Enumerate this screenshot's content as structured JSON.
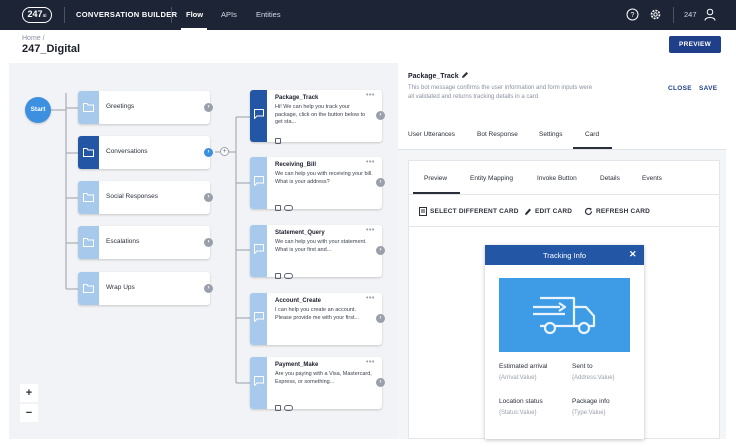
{
  "topbar": {
    "logo": "247",
    "logo_suffix": "ai",
    "app_title": "CONVERSATION BUILDER",
    "tabs": [
      {
        "label": "Flow",
        "active": true
      },
      {
        "label": "APIs",
        "active": false
      },
      {
        "label": "Entities",
        "active": false
      }
    ],
    "icons": [
      "help-icon",
      "gear-icon",
      "user-icon"
    ],
    "user_number": "247"
  },
  "header": {
    "breadcrumb": "Home /",
    "title": "247_Digital",
    "preview_label": "PREVIEW"
  },
  "flow": {
    "start_label": "Start",
    "categories": [
      {
        "label": "Greetings",
        "active": false
      },
      {
        "label": "Conversations",
        "active": true
      },
      {
        "label": "Social Responses",
        "active": false
      },
      {
        "label": "Escalations",
        "active": false
      },
      {
        "label": "Wrap Ups",
        "active": false
      }
    ],
    "messages": [
      {
        "title": "Package_Track",
        "text": "Hi! We can help you track your package, click on the button below to get sta...",
        "active": true
      },
      {
        "title": "Receiving_Bill",
        "text": "We can help you with receiving your bill. What is your address?",
        "active": false
      },
      {
        "title": "Statement_Query",
        "text": "We can help you with your statement. What is your first and...",
        "active": false
      },
      {
        "title": "Account_Create",
        "text": "I can help you create an account. Please provide me with your first...",
        "active": false
      },
      {
        "title": "Payment_Make",
        "text": "Are you paying with a Visa, Mastercard, Express, or something...",
        "active": false
      }
    ],
    "more_glyph": "•••",
    "chevron_glyph": "›",
    "zoom_in": "+",
    "zoom_out": "−"
  },
  "panel": {
    "title": "Package_Track",
    "description": "This bot message confirms the user information and form inputs were all validated and returns tracking details in a card",
    "close_label": "CLOSE",
    "save_label": "SAVE",
    "tabs": [
      {
        "label": "User Utterances",
        "active": false
      },
      {
        "label": "Bot Response",
        "active": false
      },
      {
        "label": "Settings",
        "active": false
      },
      {
        "label": "Card",
        "active": true
      }
    ],
    "subtabs": [
      {
        "label": "Preview",
        "active": true
      },
      {
        "label": "Entity Mapping",
        "active": false
      },
      {
        "label": "Invoke Button",
        "active": false
      },
      {
        "label": "Details",
        "active": false
      },
      {
        "label": "Events",
        "active": false
      }
    ],
    "actions": [
      {
        "label": "SELECT DIFFERENT CARD",
        "icon": "card-icon"
      },
      {
        "label": "EDIT CARD",
        "icon": "pencil-icon"
      },
      {
        "label": "REFRESH CARD",
        "icon": "refresh-icon"
      }
    ]
  },
  "card": {
    "title": "Tracking Info",
    "close_glyph": "✕",
    "image_icon": "delivery-truck-icon",
    "fields": [
      {
        "label": "Estimated arrival",
        "value": "{Arrival:Value}"
      },
      {
        "label": "Sent to",
        "value": "{Address:Value}"
      },
      {
        "label": "Location status",
        "value": "{Status:Value}"
      },
      {
        "label": "Package info",
        "value": "{Type:Value}"
      }
    ]
  },
  "colors": {
    "topbar": "#1c2436",
    "primary": "#1f3f8a",
    "accent_blue": "#3d8fe0",
    "node_active": "#2456a6",
    "node_tab": "#a7c9ec",
    "canvas": "#f2f3f6"
  }
}
